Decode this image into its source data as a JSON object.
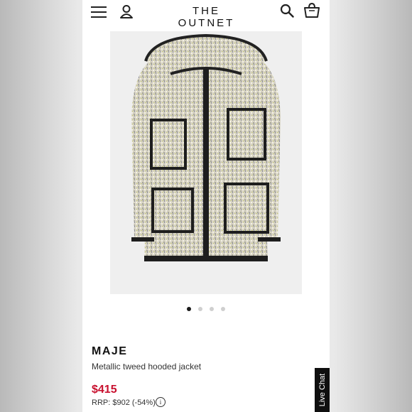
{
  "header": {
    "logo": "THE OUTNET",
    "menu_icon": "hamburger-menu-icon",
    "account_icon": "user-icon",
    "search_icon": "search-icon",
    "bag_icon": "shopping-bag-icon"
  },
  "product": {
    "image_alt": "Metallic tweed hooded jacket",
    "carousel": {
      "total": 4,
      "active": 1
    },
    "brand": "MAJE",
    "name": "Metallic tweed hooded jacket",
    "price": "$415",
    "rrp": "RRP: $902 (-54%)",
    "info_icon": "info-icon"
  },
  "live_chat": {
    "label": "Live Chat"
  },
  "colors": {
    "price": "#c8102e",
    "text": "#111111",
    "live_chat_bg": "#0f0f0f",
    "dot_active": "#1a1a1a",
    "dot_inactive": "#cfcfcf"
  }
}
